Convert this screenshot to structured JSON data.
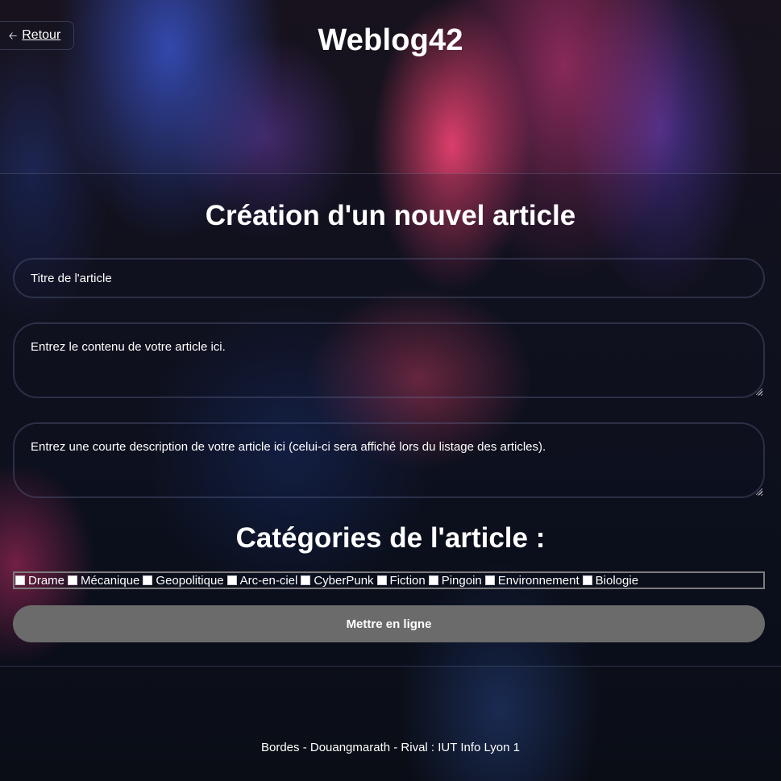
{
  "header": {
    "back_label": "Retour",
    "back_icon": "arrow-left-icon",
    "site_title": "Weblog42"
  },
  "form": {
    "heading": "Création d'un nouvel article",
    "title_placeholder": "Titre de l'article",
    "content_placeholder": "Entrez le contenu de votre article ici.",
    "description_placeholder": "Entrez une courte description de votre article ici (celui-ci sera affiché lors du listage des articles).",
    "categories_heading": "Catégories de l'article :",
    "categories": [
      {
        "label": "Drame",
        "checked": false
      },
      {
        "label": "Mécanique",
        "checked": false
      },
      {
        "label": "Geopolitique",
        "checked": false
      },
      {
        "label": "Arc-en-ciel",
        "checked": false
      },
      {
        "label": "CyberPunk",
        "checked": false
      },
      {
        "label": "Fiction",
        "checked": false
      },
      {
        "label": "Pingoin",
        "checked": false
      },
      {
        "label": "Environnement",
        "checked": false
      },
      {
        "label": "Biologie",
        "checked": false
      }
    ],
    "submit_label": "Mettre en ligne"
  },
  "footer": {
    "credits": "Bordes - Douangmarath - Rival : IUT Info Lyon 1"
  },
  "colors": {
    "submit_button": "#6b6b6b",
    "text": "#ffffff"
  }
}
